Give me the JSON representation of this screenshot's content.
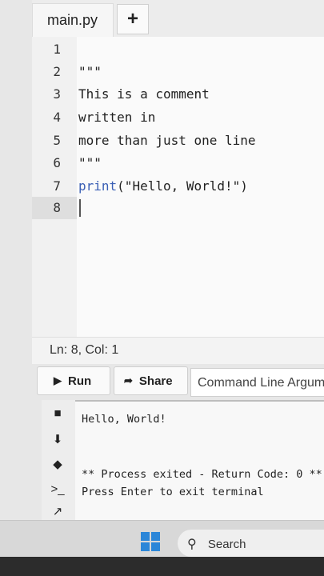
{
  "tabs": {
    "file_label": "main.py",
    "add_label": "+"
  },
  "editor": {
    "line_numbers": [
      "1",
      "2",
      "3",
      "4",
      "5",
      "6",
      "7",
      "8"
    ],
    "lines": [
      "",
      "\"\"\"",
      "This is a comment",
      "written in",
      "more than just one line",
      "\"\"\"",
      "",
      ""
    ],
    "line7": {
      "keyword": "print",
      "rest": "(\"Hello, World!\")"
    }
  },
  "status": {
    "position": "Ln: 8,  Col: 1"
  },
  "toolbar": {
    "run_label": "Run",
    "share_label": "Share",
    "args_placeholder": "Command Line Arguments"
  },
  "terminal": {
    "lines": [
      "Hello, World!",
      "",
      "",
      "** Process exited - Return Code: 0 **",
      "Press Enter to exit terminal"
    ]
  },
  "taskbar": {
    "search_label": "Search"
  },
  "colors": {
    "keyword": "#3a5fb5",
    "windows_logo": "#2b86d8"
  }
}
